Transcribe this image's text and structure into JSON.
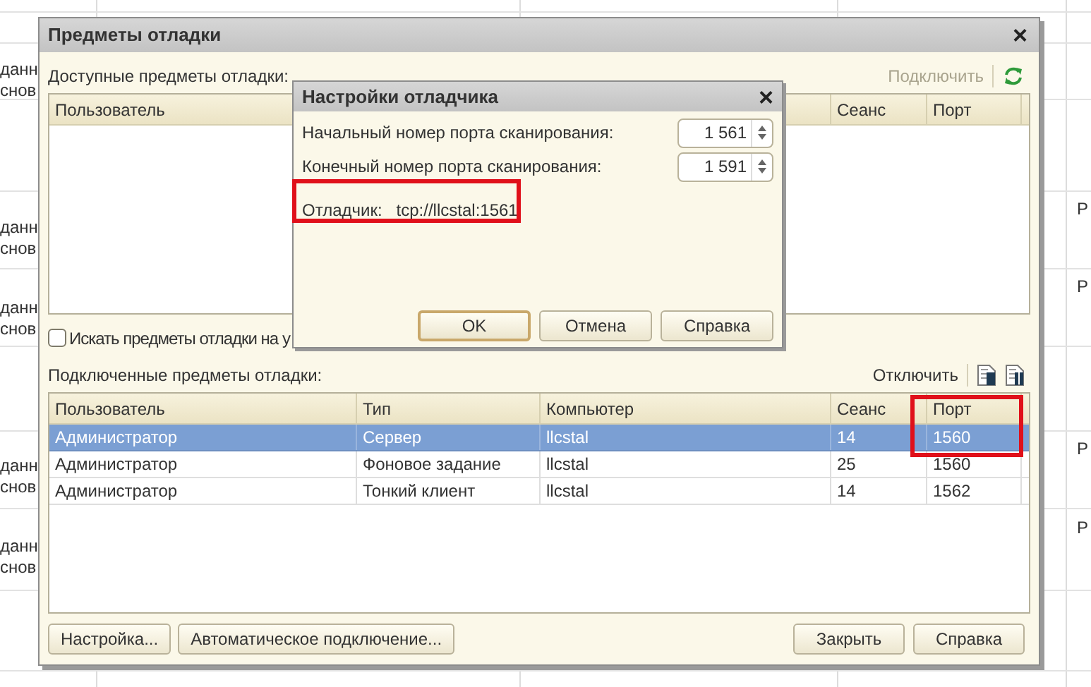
{
  "background": {
    "left_cells": [
      "данн",
      "снов",
      "данн",
      "снов",
      "данн",
      "снов",
      "данн",
      "снов",
      "данн",
      "снов"
    ],
    "right_cells": [
      "Р",
      "Р",
      "Р",
      "Р"
    ]
  },
  "dialog": {
    "title": "Предметы отладки",
    "close": "×",
    "available": {
      "label": "Доступные предметы отладки:",
      "connect_button": {
        "label": "Подключить",
        "disabled": true
      },
      "columns": [
        {
          "label": "Пользователь"
        },
        {
          "label": "Сеанс"
        },
        {
          "label": "Порт"
        }
      ],
      "search_checkbox": {
        "label": "Искать предметы отладки на у",
        "checked": false
      }
    },
    "connected": {
      "label": "Подключенные предметы отладки:",
      "disconnect_button": {
        "label": "Отключить",
        "disabled": false
      },
      "columns": [
        {
          "label": "Пользователь"
        },
        {
          "label": "Тип"
        },
        {
          "label": "Компьютер"
        },
        {
          "label": "Сеанс"
        },
        {
          "label": "Порт"
        }
      ],
      "rows": [
        {
          "cells": [
            "Администратор",
            "Сервер",
            "llcstal",
            "14",
            "1560"
          ],
          "selected": true
        },
        {
          "cells": [
            "Администратор",
            "Фоновое задание",
            "llcstal",
            "25",
            "1560"
          ],
          "selected": false
        },
        {
          "cells": [
            "Администратор",
            "Тонкий клиент",
            "llcstal",
            "14",
            "1562"
          ],
          "selected": false
        }
      ]
    },
    "buttons_left": [
      "Настройка...",
      "Автоматическое подключение..."
    ],
    "buttons_right": [
      "Закрыть",
      "Справка"
    ]
  },
  "settings_dialog": {
    "title": "Настройки отладчика",
    "close": "×",
    "fields": [
      {
        "label": "Начальный номер порта сканирования:",
        "value": "1 561"
      },
      {
        "label": "Конечный номер порта сканирования:",
        "value": "1 591"
      }
    ],
    "debugger": {
      "label": "Отладчик:",
      "value": "tcp://llcstal:1561"
    },
    "buttons": [
      {
        "label": "OK",
        "default": true
      },
      {
        "label": "Отмена",
        "default": false
      },
      {
        "label": "Справка",
        "default": false
      }
    ]
  }
}
